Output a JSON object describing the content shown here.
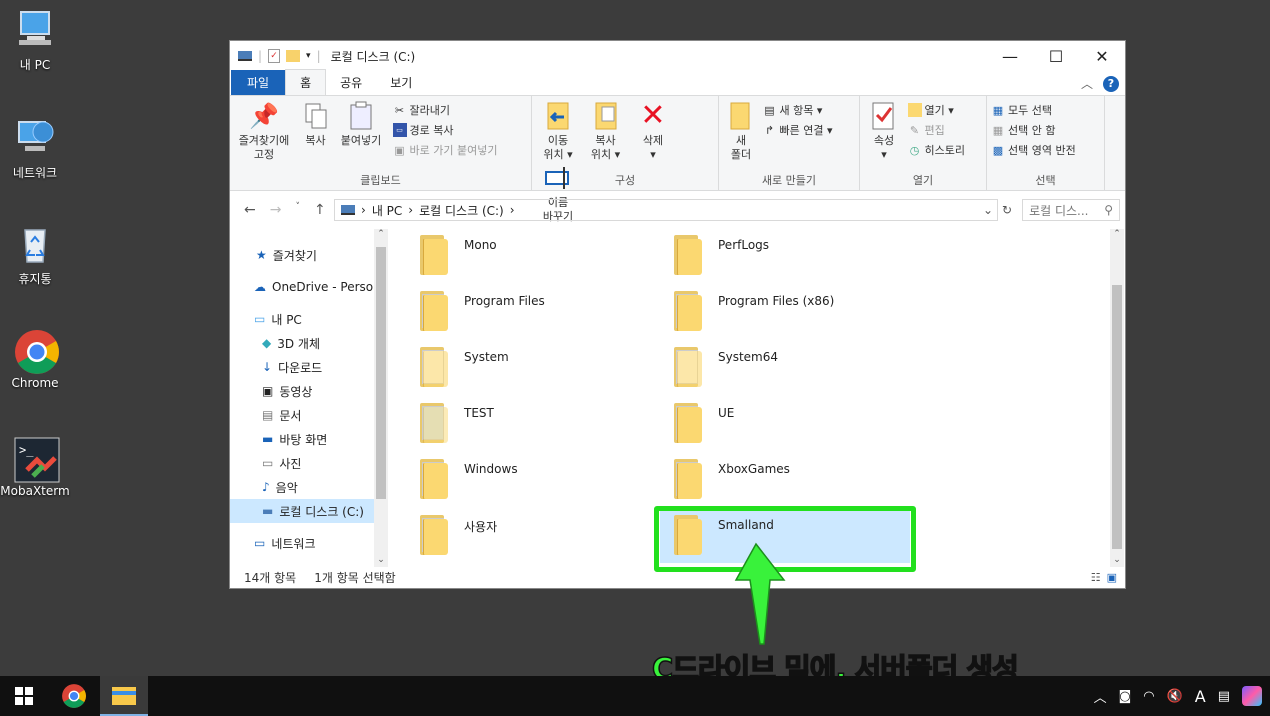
{
  "desktop": {
    "icons": [
      {
        "label": "내 PC"
      },
      {
        "label": "네트워크"
      },
      {
        "label": "휴지통"
      },
      {
        "label": "Chrome"
      },
      {
        "label": "MobaXterm"
      }
    ]
  },
  "window": {
    "title": "로컬 디스크 (C:)",
    "tabs": [
      "파일",
      "홈",
      "공유",
      "보기"
    ],
    "help": "?",
    "ribbon": {
      "clipboard": {
        "group_label": "클립보드",
        "pin": "즐겨찾기에\n고정",
        "copy": "복사",
        "paste": "붙여넣기",
        "cut": "잘라내기",
        "copy_path": "경로 복사",
        "paste_shortcut": "바로 가기 붙여넣기"
      },
      "organize": {
        "group_label": "구성",
        "move_to": "이동\n위치 ▾",
        "copy_to": "복사\n위치 ▾",
        "delete": "삭제\n▾",
        "rename": "이름\n바꾸기"
      },
      "new": {
        "group_label": "새로 만들기",
        "new_folder": "새\n폴더",
        "new_item": "새 항목 ▾",
        "easy_access": "빠른 연결 ▾"
      },
      "open": {
        "group_label": "열기",
        "properties": "속성\n▾",
        "open": "열기 ▾",
        "edit": "편집",
        "history": "히스토리"
      },
      "select": {
        "group_label": "선택",
        "select_all": "모두 선택",
        "select_none": "선택 안 함",
        "invert": "선택 영역 반전"
      }
    },
    "address": {
      "crumbs": [
        "내 PC",
        "로컬 디스크 (C:)"
      ],
      "search_placeholder": "로컬 디스..."
    },
    "nav_pane": [
      {
        "label": "즐겨찾기"
      },
      {
        "label": "OneDrive - Persor"
      },
      {
        "label": "내 PC"
      },
      {
        "label": "3D 개체"
      },
      {
        "label": "다운로드"
      },
      {
        "label": "동영상"
      },
      {
        "label": "문서"
      },
      {
        "label": "바탕 화면"
      },
      {
        "label": "사진"
      },
      {
        "label": "음악"
      },
      {
        "label": "로컬 디스크 (C:)"
      },
      {
        "label": "네트워크"
      }
    ],
    "files": [
      {
        "name": "Mono"
      },
      {
        "name": "PerfLogs"
      },
      {
        "name": "Program Files"
      },
      {
        "name": "Program Files (x86)"
      },
      {
        "name": "System"
      },
      {
        "name": "System64"
      },
      {
        "name": "TEST"
      },
      {
        "name": "UE"
      },
      {
        "name": "Windows"
      },
      {
        "name": "XboxGames"
      },
      {
        "name": "사용자"
      },
      {
        "name": "Smalland"
      }
    ],
    "status": {
      "count": "14개 항목",
      "selected": "1개 항목 선택함"
    }
  },
  "annotation": {
    "caption": "C드라이브 밑에, 서버폴더 생성",
    "highlight_color": "#22e01e"
  },
  "taskbar": {
    "tray_lang": "A"
  }
}
